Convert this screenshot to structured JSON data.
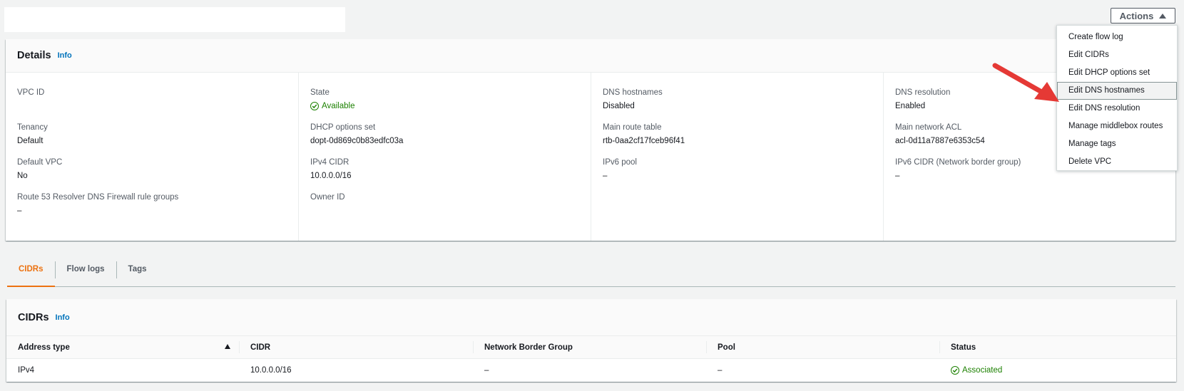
{
  "header": {
    "actions_label": "Actions"
  },
  "details": {
    "title": "Details",
    "info": "Info",
    "columns": [
      [
        {
          "label": "VPC ID",
          "value": ""
        },
        {
          "label": "Tenancy",
          "value": "Default"
        },
        {
          "label": "Default VPC",
          "value": "No"
        },
        {
          "label": "Route 53 Resolver DNS Firewall rule groups",
          "value": "–"
        }
      ],
      [
        {
          "label": "State",
          "value": "Available"
        },
        {
          "label": "DHCP options set",
          "value": "dopt-0d869c0b83edfc03a"
        },
        {
          "label": "IPv4 CIDR",
          "value": "10.0.0.0/16"
        },
        {
          "label": "Owner ID",
          "value": ""
        }
      ],
      [
        {
          "label": "DNS hostnames",
          "value": "Disabled"
        },
        {
          "label": "Main route table",
          "value": "rtb-0aa2cf17fceb96f41"
        },
        {
          "label": "IPv6 pool",
          "value": "–"
        }
      ],
      [
        {
          "label": "DNS resolution",
          "value": "Enabled"
        },
        {
          "label": "Main network ACL",
          "value": "acl-0d11a7887e6353c54"
        },
        {
          "label": "IPv6 CIDR (Network border group)",
          "value": "–"
        }
      ]
    ]
  },
  "tabs": [
    {
      "label": "CIDRs",
      "active": true
    },
    {
      "label": "Flow logs",
      "active": false
    },
    {
      "label": "Tags",
      "active": false
    }
  ],
  "cidrs": {
    "title": "CIDRs",
    "info": "Info",
    "headers": [
      "Address type",
      "CIDR",
      "Network Border Group",
      "Pool",
      "Status"
    ],
    "rows": [
      [
        "IPv4",
        "10.0.0.0/16",
        "–",
        "–",
        "Associated"
      ]
    ]
  },
  "actions_menu": {
    "items": [
      "Create flow log",
      "Edit CIDRs",
      "Edit DHCP options set",
      "Edit DNS hostnames",
      "Edit DNS resolution",
      "Manage middlebox routes",
      "Manage tags",
      "Delete VPC"
    ],
    "hovered": "Edit DNS hostnames"
  },
  "colors": {
    "accent": "#ec7211",
    "link": "#0073bb",
    "success": "#1d8102",
    "annotation_arrow": "#e53935"
  }
}
